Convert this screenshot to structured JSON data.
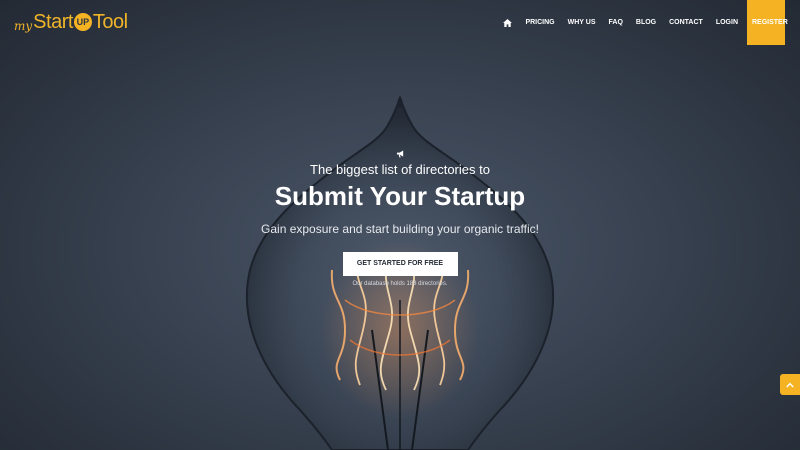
{
  "header": {
    "logo": {
      "my": "my",
      "start": "Start",
      "up": "UP",
      "tool": "Tool"
    },
    "nav": {
      "home_icon": "home-icon",
      "items": [
        {
          "label": "PRICING"
        },
        {
          "label": "WHY US"
        },
        {
          "label": "FAQ"
        },
        {
          "label": "BLOG"
        },
        {
          "label": "CONTACT"
        },
        {
          "label": "LOGIN"
        }
      ],
      "register_label": "REGISTER"
    }
  },
  "hero": {
    "icon": "megaphone-icon",
    "tagline": "The biggest list of directories to",
    "headline": "Submit Your Startup",
    "subline": "Gain exposure and start building your organic traffic!",
    "cta_label": "GET STARTED FOR FREE",
    "db_note": "Our database holds 188 directories."
  },
  "scroll_top": {
    "icon": "chevron-up-icon"
  },
  "colors": {
    "accent": "#f5b324",
    "background": "#333c49",
    "text": "#ffffff"
  }
}
